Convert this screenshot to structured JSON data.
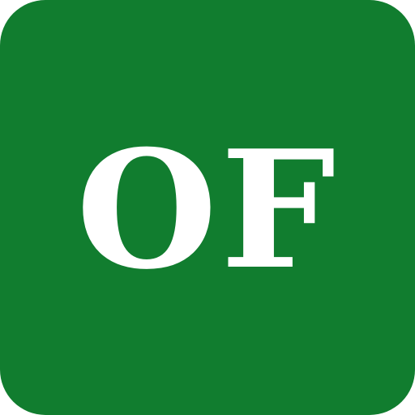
{
  "icon": {
    "name": "of-monogram-app-icon",
    "text": "OF",
    "background_color": "#117d2f",
    "text_color": "#ffffff"
  }
}
